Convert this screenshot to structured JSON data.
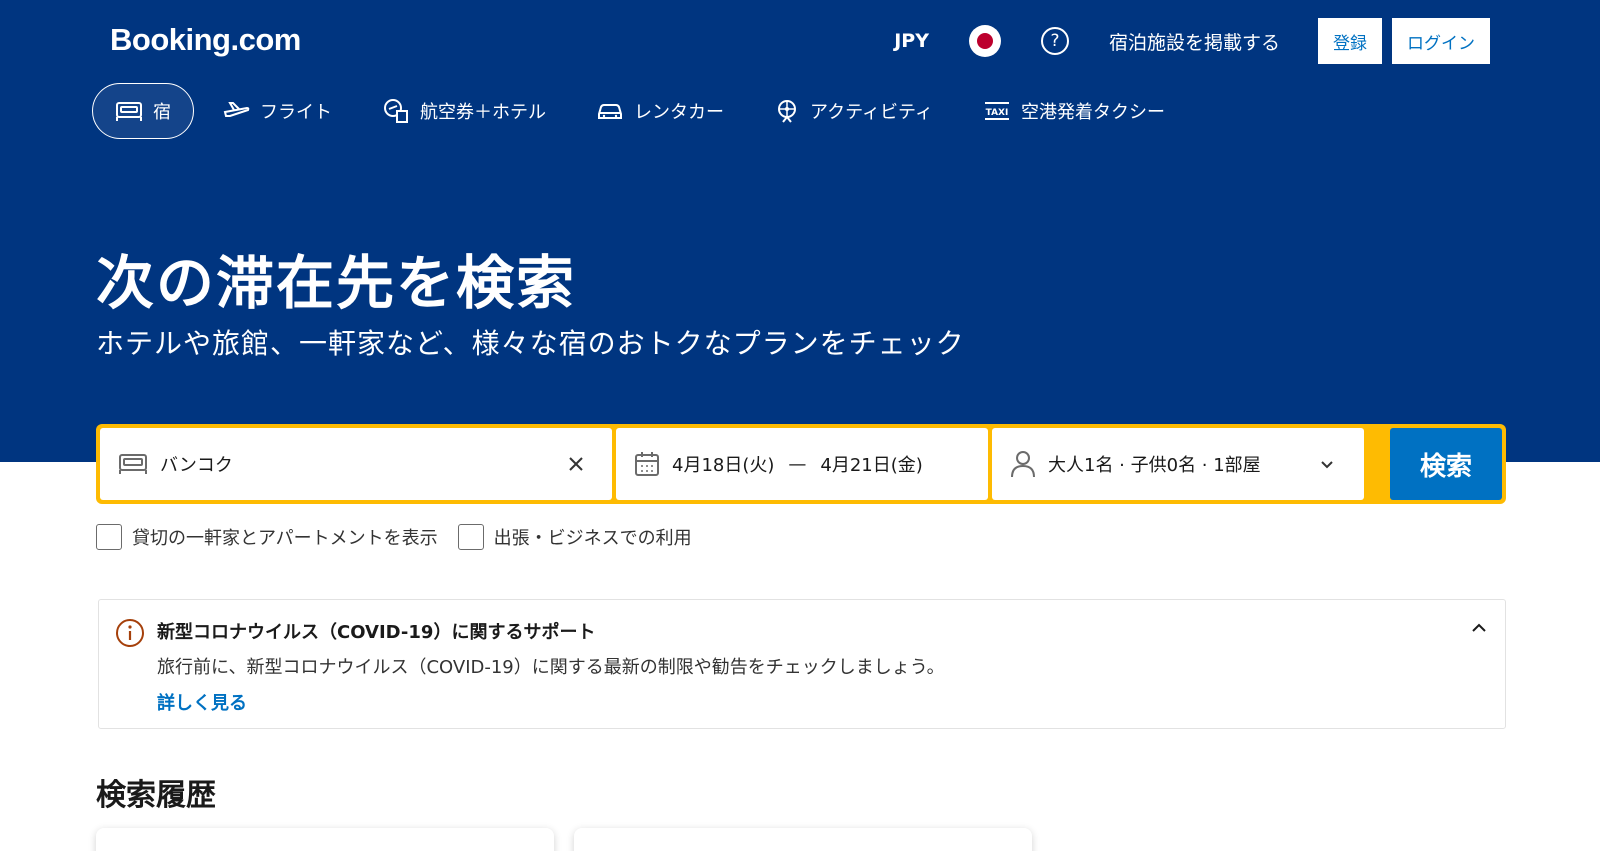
{
  "header": {
    "logo": "Booking.com",
    "currency": "JPY",
    "help_icon_glyph": "?",
    "list_property": "宿泊施設を掲載する",
    "register": "登録",
    "login": "ログイン"
  },
  "tabs": [
    {
      "label": "宿",
      "icon": "bed-icon",
      "active": true
    },
    {
      "label": "フライト",
      "icon": "plane-icon"
    },
    {
      "label": "航空券＋ホテル",
      "icon": "flight-hotel-icon"
    },
    {
      "label": "レンタカー",
      "icon": "car-icon"
    },
    {
      "label": "アクティビティ",
      "icon": "attractions-icon"
    },
    {
      "label": "空港発着タクシー",
      "icon": "taxi-icon"
    }
  ],
  "hero": {
    "title": "次の滞在先を検索",
    "subtitle": "ホテルや旅館、一軒家など、様々な宿のおトクなプランをチェック"
  },
  "search": {
    "destination": "バンコク",
    "checkin": "4月18日(火)",
    "separator": "—",
    "checkout": "4月21日(金)",
    "guests": "大人1名 · 子供0名 · 1部屋",
    "button": "検索"
  },
  "checkboxes": [
    {
      "label": "貸切の一軒家とアパートメントを表示",
      "checked": false
    },
    {
      "label": "出張・ビジネスでの利用",
      "checked": false
    }
  ],
  "notice": {
    "title": "新型コロナウイルス（COVID-19）に関するサポート",
    "text": "旅行前に、新型コロナウイルス（COVID-19）に関する最新の制限や勧告をチェックしましょう。",
    "link": "詳しく見る"
  },
  "history": {
    "title": "検索履歴"
  },
  "colors": {
    "brand_blue": "#003580",
    "accent_yellow": "#febb02",
    "action_blue": "#0071c2",
    "notice_orange": "#a5400b"
  }
}
